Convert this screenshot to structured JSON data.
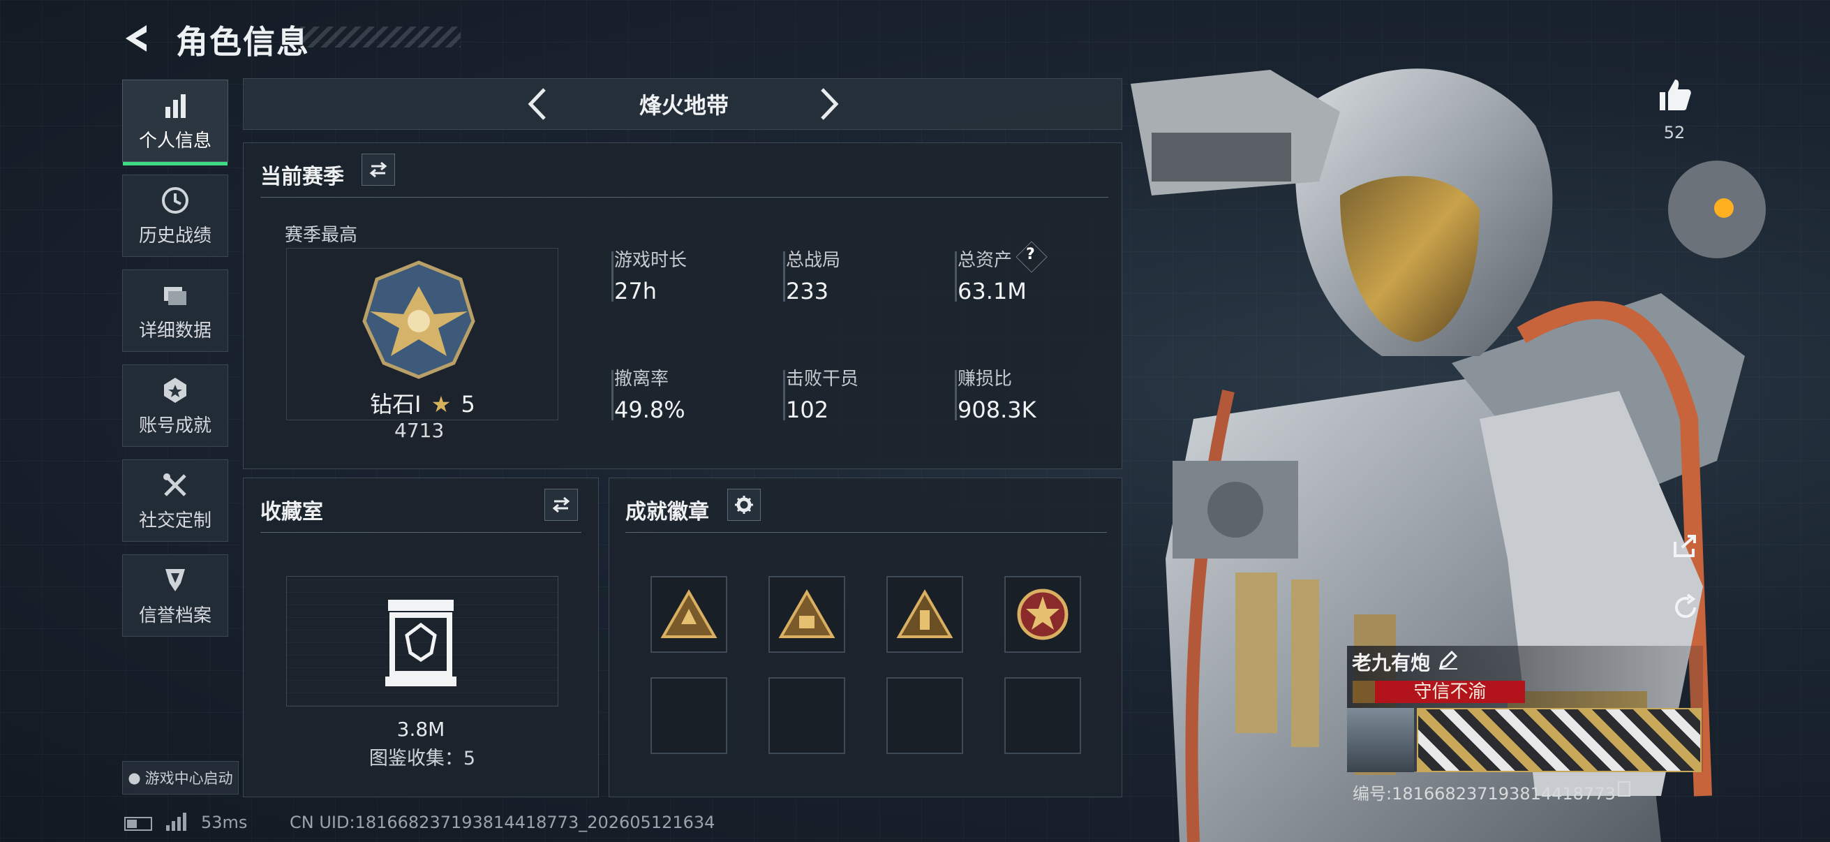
{
  "header": {
    "title": "角色信息"
  },
  "sidebar": {
    "items": [
      {
        "label": "个人信息",
        "icon": "bar-chart-icon",
        "active": true
      },
      {
        "label": "历史战绩",
        "icon": "clock-icon"
      },
      {
        "label": "详细数据",
        "icon": "folder-icon"
      },
      {
        "label": "账号成就",
        "icon": "medal-icon"
      },
      {
        "label": "社交定制",
        "icon": "tools-icon"
      },
      {
        "label": "信誉档案",
        "icon": "shield-icon"
      }
    ],
    "launcher": "游戏中心启动"
  },
  "mode": {
    "name": "烽火地带"
  },
  "season": {
    "title": "当前赛季",
    "best_label": "赛季最高",
    "rank_name": "钻石Ⅰ",
    "rank_stars": "5",
    "rank_score": "4713",
    "stats": [
      {
        "label": "游戏时长",
        "value": "27h"
      },
      {
        "label": "总战局",
        "value": "233"
      },
      {
        "label": "总资产",
        "value": "63.1M"
      },
      {
        "label": "撤离率",
        "value": "49.8%"
      },
      {
        "label": "击败干员",
        "value": "102"
      },
      {
        "label": "赚损比",
        "value": "908.3K"
      }
    ]
  },
  "collection": {
    "title": "收藏室",
    "value": "3.8M",
    "count_text": "图鉴收集：5"
  },
  "achievements": {
    "title": "成就徽章"
  },
  "likes": {
    "count": "52"
  },
  "profile": {
    "name": "老九有炮",
    "motto": "守信不渝",
    "id_text": "编号:1816682371938144187​73"
  },
  "footer": {
    "ping": "53ms",
    "uid": "CN UID:181668237193814418773_202605121634"
  },
  "colors": {
    "accent": "#3ddc84",
    "motto_bg": "#b3141b",
    "gold": "#c9a24a"
  }
}
